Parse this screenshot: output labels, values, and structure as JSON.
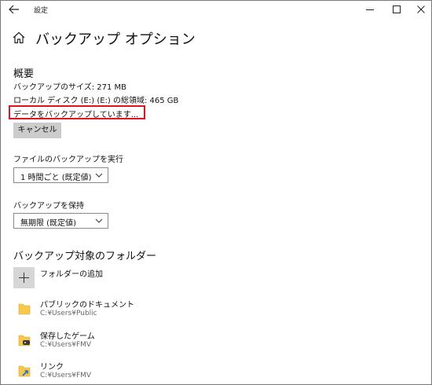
{
  "window": {
    "title": "設定"
  },
  "page": {
    "title": "バックアップ オプション"
  },
  "overview": {
    "heading": "概要",
    "backup_size": "バックアップのサイズ: 271 MB",
    "disk_space": "ローカル ディスク (E:) (E:) の総領域: 465 GB",
    "status": "データをバックアップしています...",
    "cancel_label": "キャンセル"
  },
  "backup_frequency": {
    "label": "ファイルのバックアップを実行",
    "selected": "1 時間ごと (既定値)"
  },
  "keep_backups": {
    "label": "バックアップを保持",
    "selected": "無期限 (既定値)"
  },
  "folders": {
    "heading": "バックアップ対象のフォルダー",
    "add_label": "フォルダーの追加",
    "items": [
      {
        "name": "パブリックのドキュメント",
        "path": "C:¥Users¥Public",
        "icon": "folder-icon"
      },
      {
        "name": "保存したゲーム",
        "path": "C:¥Users¥FMV",
        "icon": "saved-games-icon"
      },
      {
        "name": "リンク",
        "path": "C:¥Users¥FMV",
        "icon": "links-icon"
      }
    ]
  },
  "colors": {
    "highlight_border": "#e3121c",
    "button_bg": "#cccccc",
    "folder": "#f6c94e"
  }
}
